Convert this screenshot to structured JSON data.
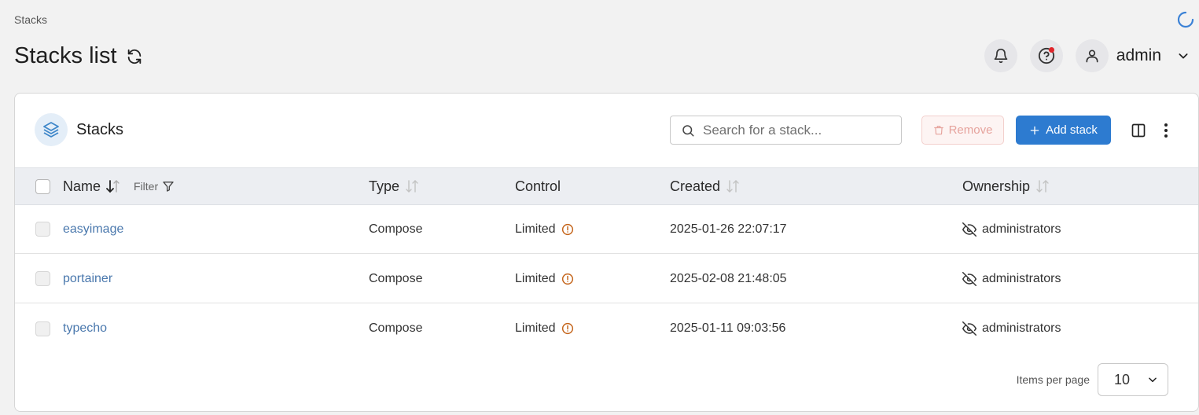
{
  "breadcrumb": "Stacks",
  "page_title": "Stacks list",
  "user": {
    "name": "admin"
  },
  "card": {
    "title": "Stacks",
    "search_placeholder": "Search for a stack...",
    "remove_label": "Remove",
    "add_label": "Add stack"
  },
  "table": {
    "headers": {
      "name": "Name",
      "filter": "Filter",
      "type": "Type",
      "control": "Control",
      "created": "Created",
      "ownership": "Ownership"
    },
    "rows": [
      {
        "name": "easyimage",
        "type": "Compose",
        "control": "Limited",
        "created": "2025-01-26 22:07:17",
        "ownership": "administrators"
      },
      {
        "name": "portainer",
        "type": "Compose",
        "control": "Limited",
        "created": "2025-02-08 21:48:05",
        "ownership": "administrators"
      },
      {
        "name": "typecho",
        "type": "Compose",
        "control": "Limited",
        "created": "2025-01-11 09:03:56",
        "ownership": "administrators"
      }
    ]
  },
  "pagination": {
    "label": "Items per page",
    "value": "10"
  },
  "colors": {
    "primary": "#2d7bd0",
    "link": "#4a78ad",
    "warning": "#c4641a",
    "danger_light": "#e6a39d"
  },
  "icons": [
    "refresh-icon",
    "bell-icon",
    "help-icon",
    "user-icon",
    "chevron-down-icon",
    "stacks-icon",
    "search-icon",
    "trash-icon",
    "plus-icon",
    "columns-icon",
    "kebab-icon",
    "sort-icon",
    "filter-icon",
    "warning-circle-icon",
    "eye-off-icon",
    "loading-spinner-icon"
  ]
}
